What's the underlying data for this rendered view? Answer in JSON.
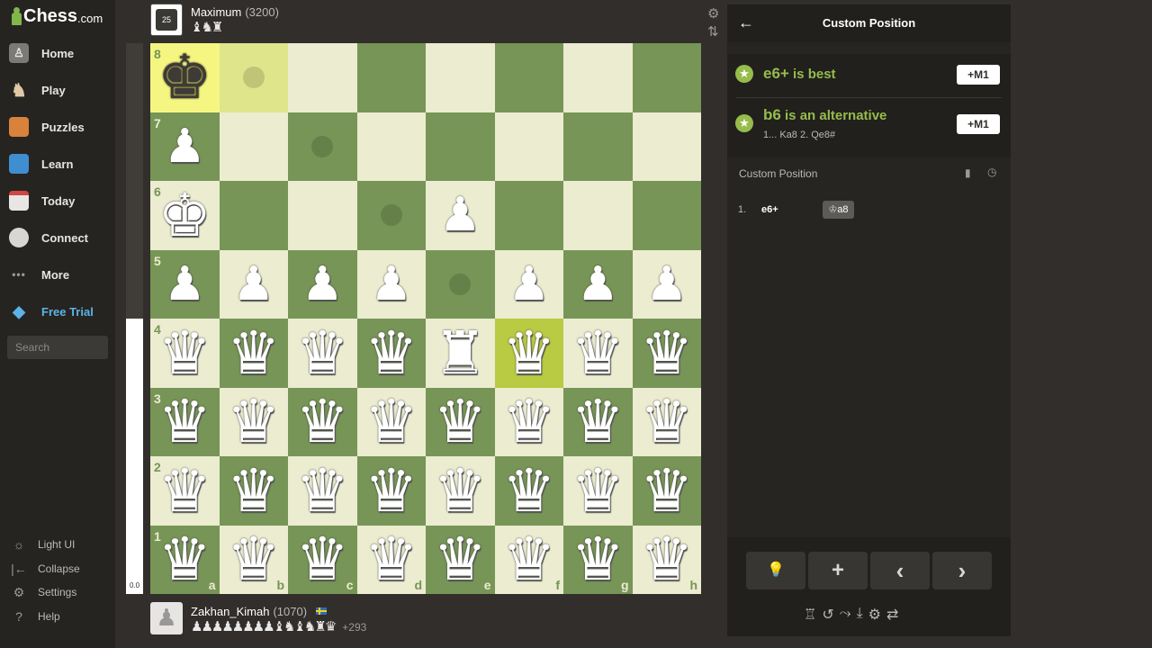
{
  "sidebar": {
    "logo": "Chess",
    "logo_suffix": ".com",
    "items": [
      {
        "label": "Home",
        "icon": "home-icon"
      },
      {
        "label": "Play",
        "icon": "play-icon"
      },
      {
        "label": "Puzzles",
        "icon": "puzzles-icon"
      },
      {
        "label": "Learn",
        "icon": "learn-icon"
      },
      {
        "label": "Today",
        "icon": "today-icon"
      },
      {
        "label": "Connect",
        "icon": "connect-icon"
      },
      {
        "label": "More",
        "icon": "more-icon"
      },
      {
        "label": "Free Trial",
        "icon": "diamond-icon"
      }
    ],
    "search_placeholder": "Search",
    "bottom": [
      {
        "label": "Light UI",
        "icon": "sun-icon"
      },
      {
        "label": "Collapse",
        "icon": "collapse-icon"
      },
      {
        "label": "Settings",
        "icon": "gear-icon"
      },
      {
        "label": "Help",
        "icon": "help-icon"
      }
    ]
  },
  "opponent": {
    "badge": "25",
    "name": "Maximum",
    "rating": "(3200)",
    "captured": "♝♞♜"
  },
  "player": {
    "name": "Zakhan_Kimah",
    "rating": "(1070)",
    "captured": "♟♟♟♟♟♟♟♟♝♞♝♞♜♛",
    "advantage": "+293"
  },
  "eval_bar": {
    "value": "0.0",
    "white_fraction": 0.5
  },
  "board": {
    "ranks": [
      "8",
      "7",
      "6",
      "5",
      "4",
      "3",
      "2",
      "1"
    ],
    "files": [
      "a",
      "b",
      "c",
      "d",
      "e",
      "f",
      "g",
      "h"
    ],
    "rows": [
      [
        "bK",
        "",
        "",
        "",
        "",
        "",
        "",
        ""
      ],
      [
        "wP",
        "",
        "",
        "",
        "",
        "",
        "",
        ""
      ],
      [
        "wK",
        "",
        "",
        "",
        "wP",
        "",
        "",
        ""
      ],
      [
        "wP",
        "wP",
        "wP",
        "wP",
        "",
        "wP",
        "wP",
        "wP"
      ],
      [
        "wQ",
        "wQ",
        "wQ",
        "wQ",
        "wR",
        "wQ",
        "wQ",
        "wQ"
      ],
      [
        "wQ",
        "wQ",
        "wQ",
        "wQ",
        "wQ",
        "wQ",
        "wQ",
        "wQ"
      ],
      [
        "wQ",
        "wQ",
        "wQ",
        "wQ",
        "wQ",
        "wQ",
        "wQ",
        "wQ"
      ],
      [
        "wQ",
        "wQ",
        "wQ",
        "wQ",
        "wQ",
        "wQ",
        "wQ",
        "wQ"
      ]
    ],
    "highlight_squares": [
      "a8",
      "b8"
    ],
    "selected_square": "f4",
    "move_dots": [
      "b8",
      "c7",
      "d6",
      "e5"
    ]
  },
  "panel": {
    "title": "Custom Position",
    "best": {
      "move": "e6+",
      "text": " is best",
      "eval": "+M1"
    },
    "alternative": {
      "move": "b6",
      "text": " is an alternative",
      "line": "1... Ka8 2. Qe8#",
      "eval": "+M1"
    },
    "section_title": "Custom Position",
    "moves": [
      {
        "num": "1.",
        "white": "e6+",
        "black": "a8"
      }
    ],
    "controls": [
      "💡",
      "+",
      "‹",
      "›"
    ]
  }
}
